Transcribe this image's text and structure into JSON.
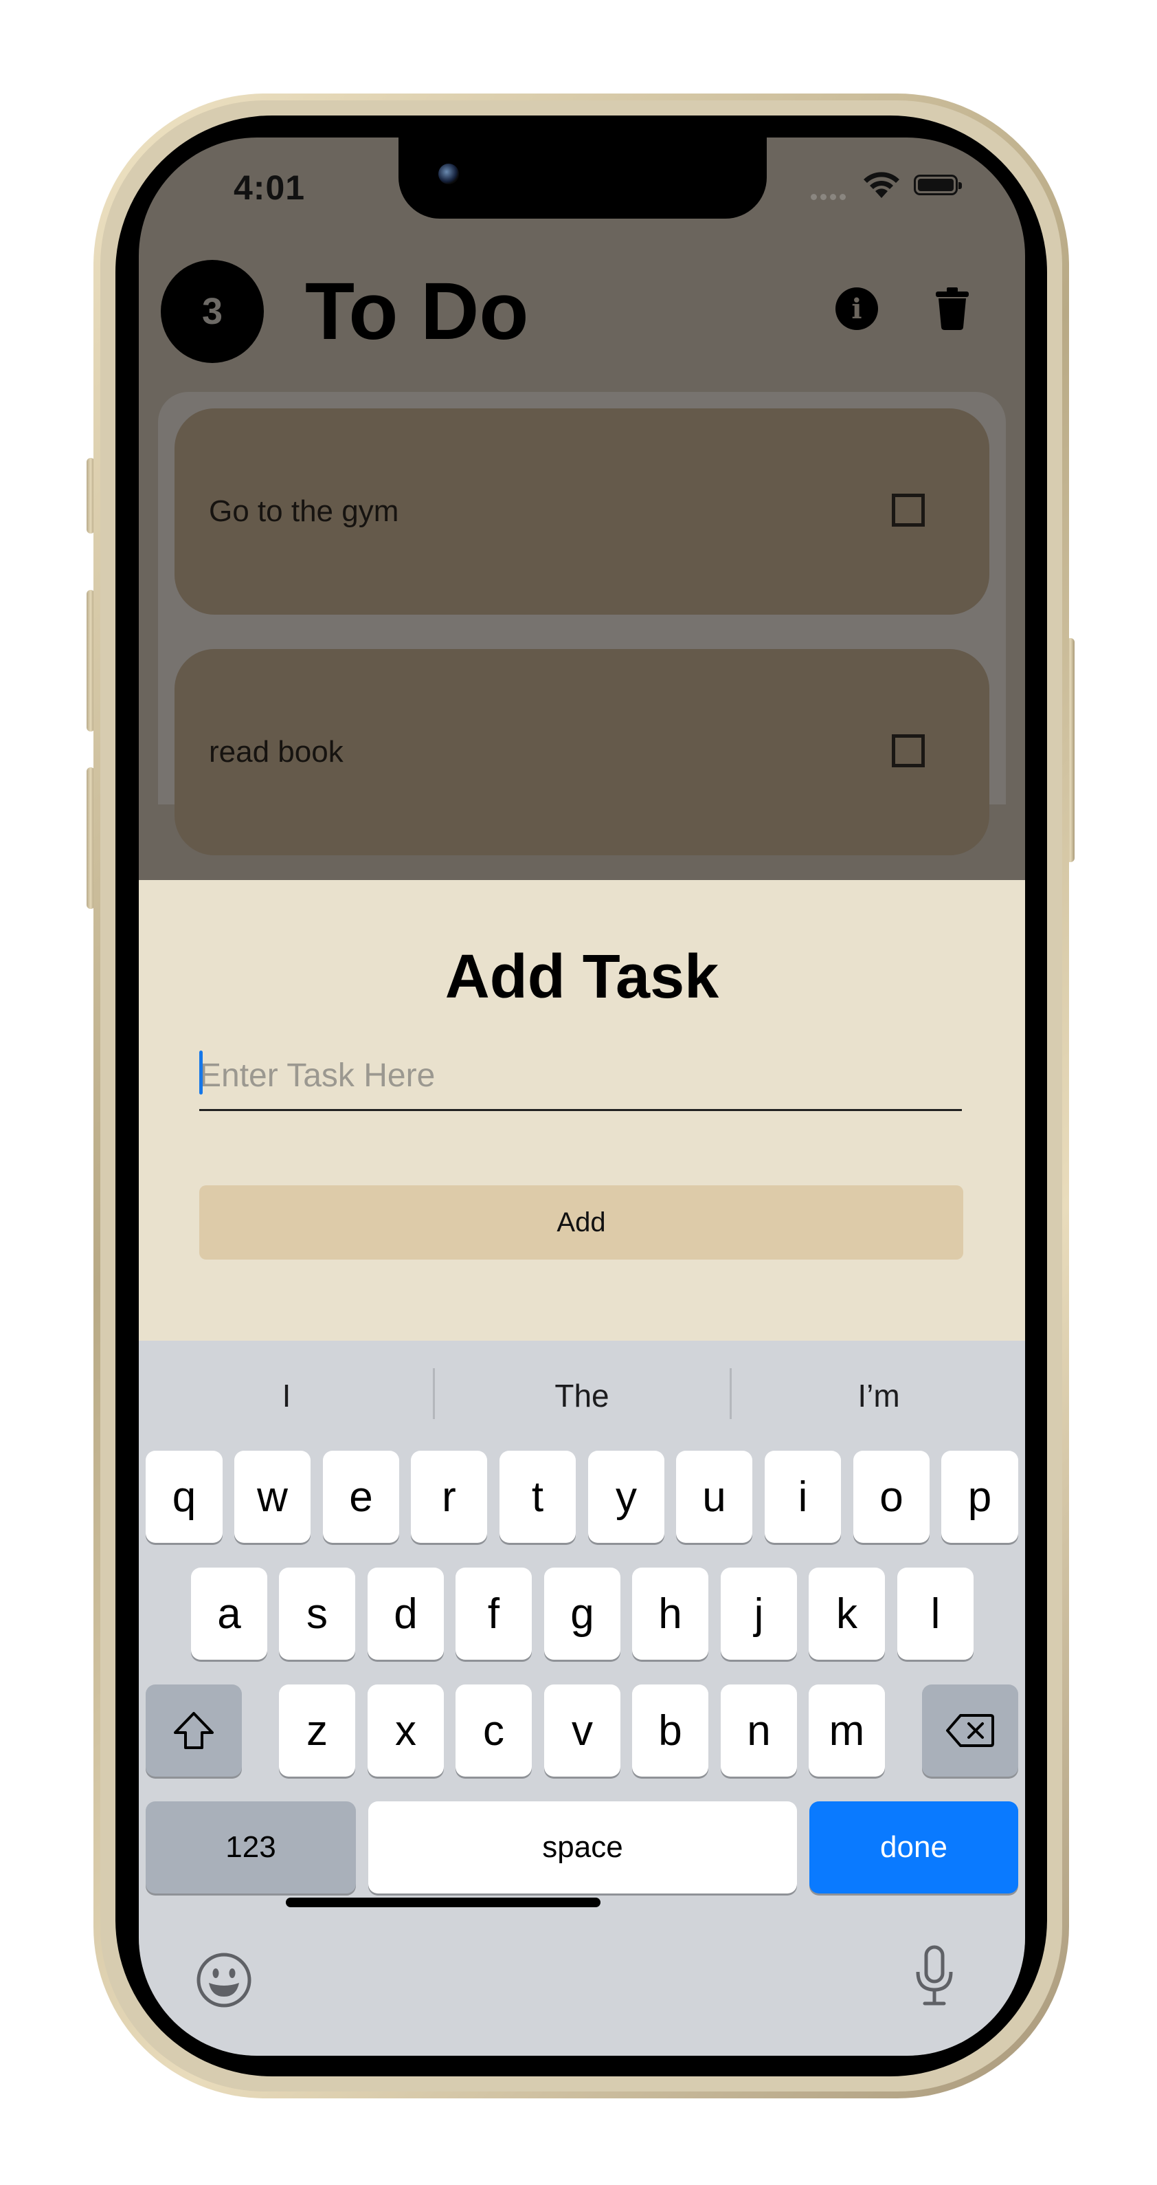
{
  "status_bar": {
    "time": "4:01"
  },
  "header": {
    "task_count": "3",
    "title": "To Do"
  },
  "tasks": [
    {
      "label": "Go to the gym",
      "done": false
    },
    {
      "label": "read book",
      "done": false
    }
  ],
  "add_sheet": {
    "title": "Add Task",
    "input_placeholder": "Enter Task Here",
    "input_value": "",
    "button_label": "Add"
  },
  "keyboard": {
    "suggestions": [
      "I",
      "The",
      "I’m"
    ],
    "row1": [
      "q",
      "w",
      "e",
      "r",
      "t",
      "y",
      "u",
      "i",
      "o",
      "p"
    ],
    "row2": [
      "a",
      "s",
      "d",
      "f",
      "g",
      "h",
      "j",
      "k",
      "l"
    ],
    "row3": [
      "z",
      "x",
      "c",
      "v",
      "b",
      "n",
      "m"
    ],
    "numbers_label": "123",
    "space_label": "space",
    "done_label": "done"
  },
  "colors": {
    "dimmed_background": "#6b655d",
    "task_card": "#655a4b",
    "sheet_background": "#e9e1cd",
    "add_button": "#ddcba9",
    "keyboard_background": "#d1d4d9",
    "done_key": "#0a7aff"
  },
  "icons": [
    "info-icon",
    "trash-icon",
    "checkbox-icon",
    "shift-icon",
    "delete-icon",
    "emoji-icon",
    "microphone-icon",
    "wifi-icon",
    "battery-icon"
  ]
}
